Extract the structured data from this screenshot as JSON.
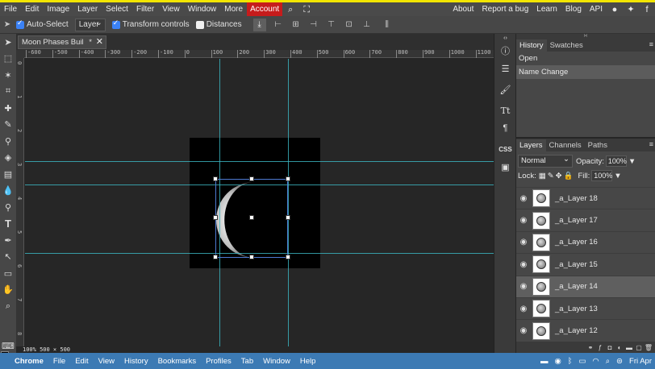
{
  "menubar": {
    "items": [
      "File",
      "Edit",
      "Image",
      "Layer",
      "Select",
      "Filter",
      "View",
      "Window",
      "More"
    ],
    "account": "Account",
    "right_items": [
      "About",
      "Report a bug",
      "Learn",
      "Blog",
      "API"
    ]
  },
  "options": {
    "auto_select_label": "Auto-Select",
    "auto_select_checked": true,
    "target_select": "Layer",
    "transform_controls_label": "Transform controls",
    "transform_controls_checked": true,
    "distances_label": "Distances",
    "distances_checked": false
  },
  "document": {
    "tab_title": "Moon Phases Buil",
    "tab_modified": "*",
    "status": "100%   500 × 500"
  },
  "ruler": {
    "h_labels": [
      "-600",
      "-500",
      "-400",
      "-300",
      "-200",
      "-100",
      "0",
      "100",
      "200",
      "300",
      "400",
      "500",
      "600",
      "700",
      "800",
      "900",
      "1000",
      "1100"
    ],
    "v_labels": [
      "0",
      "1",
      "2",
      "3",
      "4",
      "5",
      "6",
      "7",
      "8"
    ]
  },
  "history_panel": {
    "tabs": [
      "History",
      "Swatches"
    ],
    "active_tab": "History",
    "items": [
      "Open",
      "Name Change"
    ],
    "selected_index": 1
  },
  "layers_panel": {
    "tabs": [
      "Layers",
      "Channels",
      "Paths"
    ],
    "active_tab": "Layers",
    "blend_mode": "Normal",
    "opacity_label": "Opacity:",
    "opacity_value": "100%",
    "lock_label": "Lock:",
    "fill_label": "Fill:",
    "fill_value": "100%",
    "layers": [
      {
        "name": "_a_Layer 18",
        "selected": false
      },
      {
        "name": "_a_Layer 17",
        "selected": false
      },
      {
        "name": "_a_Layer 16",
        "selected": false
      },
      {
        "name": "_a_Layer 15",
        "selected": false
      },
      {
        "name": "_a_Layer 14",
        "selected": true
      },
      {
        "name": "_a_Layer 13",
        "selected": false
      },
      {
        "name": "_a_Layer 12",
        "selected": false
      }
    ]
  },
  "dock": {
    "apple": "",
    "items": [
      "Chrome",
      "File",
      "Edit",
      "View",
      "History",
      "Bookmarks",
      "Profiles",
      "Tab",
      "Window",
      "Help"
    ],
    "clock": "Fri Apr"
  },
  "colors": {
    "accent_account": "#c61c1c",
    "guide": "#3cb9c6",
    "dock": "#3c7ab4"
  }
}
